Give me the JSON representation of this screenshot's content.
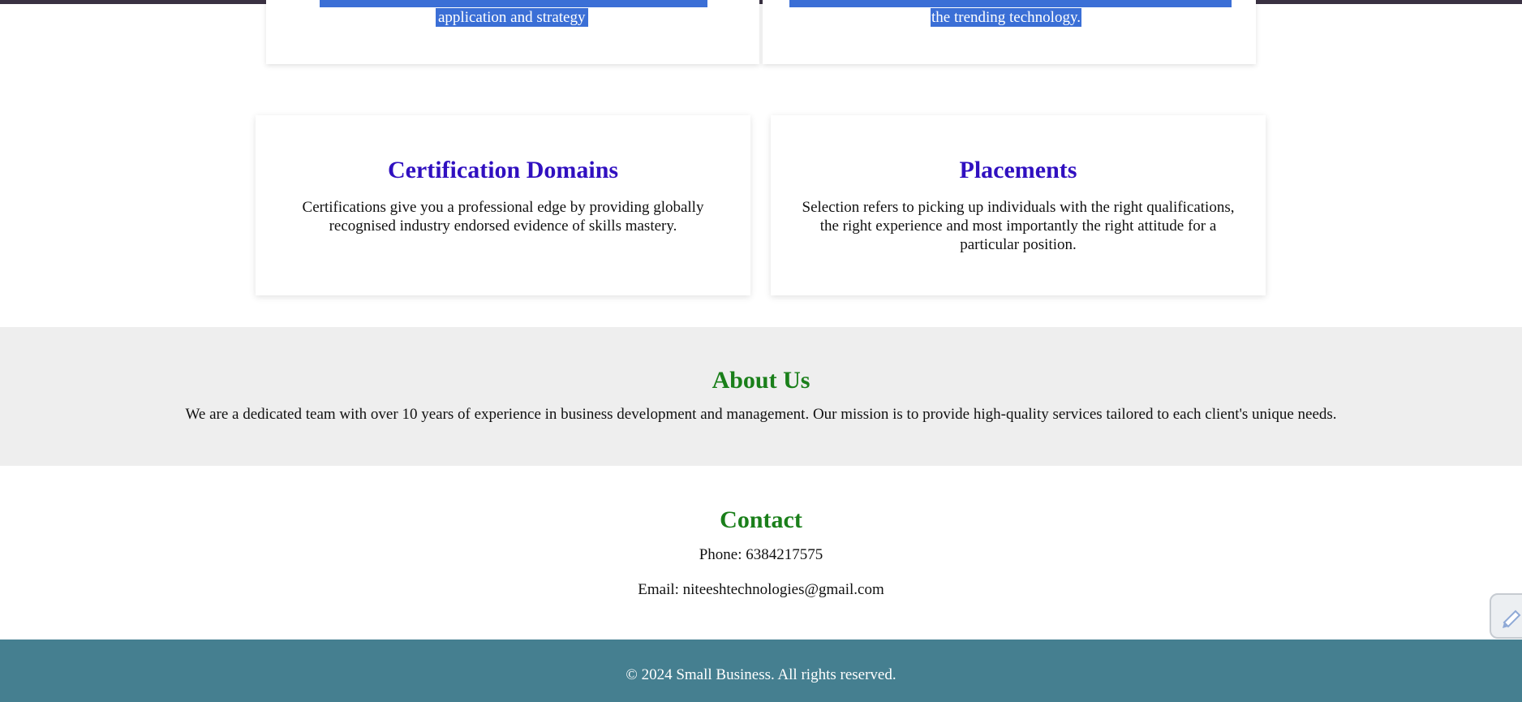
{
  "top_cards": {
    "left_last_line": "application and strategy",
    "right_last_line": "the trending technology."
  },
  "cards": [
    {
      "title": "Certification Domains",
      "text": "Certifications give you a professional edge by providing globally recognised industry endorsed evidence of skills mastery."
    },
    {
      "title": "Placements",
      "text": "Selection refers to picking up individuals with the right qualifications, the right experience and most importantly the right attitude for a particular position."
    }
  ],
  "about": {
    "heading": "About Us",
    "text": "We are a dedicated team with over 10 years of experience in business development and management. Our mission is to provide high-quality services tailored to each client's unique needs."
  },
  "contact": {
    "heading": "Contact",
    "phone": "Phone: 6384217575",
    "email": "Email: niteeshtechnologies@gmail.com"
  },
  "footer": {
    "text": "© 2024 Small Business. All rights reserved."
  },
  "widget": {
    "icon": "pencil-icon"
  },
  "colors": {
    "card_heading": "#3010c0",
    "section_heading": "#1a7f1a",
    "footer_bg": "#457f90",
    "about_bg": "#eeeeee",
    "selection": "#3b6fd6"
  }
}
